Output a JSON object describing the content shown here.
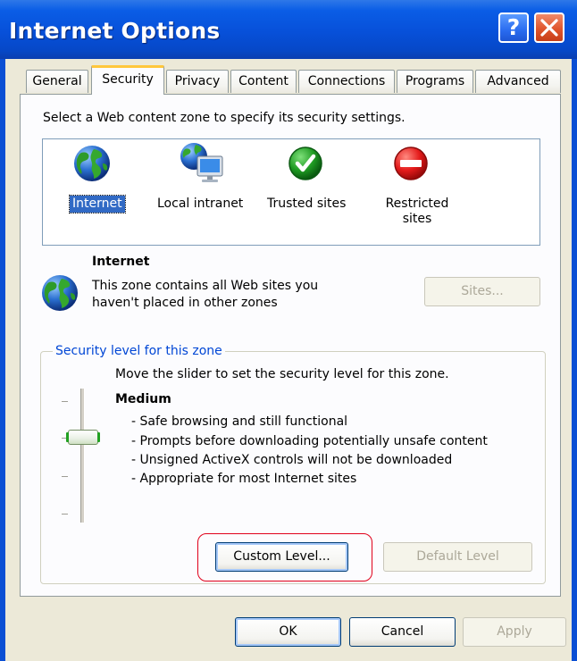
{
  "window": {
    "title": "Internet Options"
  },
  "titlebar_buttons": {
    "help": "?",
    "close": "close"
  },
  "tabs": [
    {
      "label": "General",
      "active": false
    },
    {
      "label": "Security",
      "active": true
    },
    {
      "label": "Privacy",
      "active": false
    },
    {
      "label": "Content",
      "active": false
    },
    {
      "label": "Connections",
      "active": false
    },
    {
      "label": "Programs",
      "active": false
    },
    {
      "label": "Advanced",
      "active": false
    }
  ],
  "security": {
    "instruction": "Select a Web content zone to specify its security settings.",
    "zones": [
      {
        "label": "Internet",
        "icon": "globe-icon",
        "selected": true
      },
      {
        "label": "Local intranet",
        "icon": "local-intranet-icon",
        "selected": false
      },
      {
        "label": "Trusted sites",
        "icon": "checkmark-icon",
        "selected": false
      },
      {
        "label_line1": "Restricted",
        "label_line2": "sites",
        "icon": "restricted-icon",
        "selected": false
      }
    ],
    "selected_zone": {
      "title": "Internet",
      "desc_line1": "This zone contains all Web sites you",
      "desc_line2": "haven't placed in other zones",
      "sites_button": "Sites..."
    },
    "level_group": {
      "label": "Security level for this zone",
      "instruction": "Move the slider to set the security level for this zone.",
      "level": "Medium",
      "bullets": [
        "- Safe browsing and still functional",
        "- Prompts before downloading potentially unsafe content",
        "- Unsigned ActiveX controls will not be downloaded",
        "- Appropriate for most Internet sites"
      ],
      "custom_button": "Custom Level...",
      "default_button": "Default Level"
    }
  },
  "footer": {
    "ok": "OK",
    "cancel": "Cancel",
    "apply": "Apply"
  },
  "colors": {
    "titlebar": "#0a5de6",
    "highlight": "#e0001a",
    "active_tab_accent": "#ffc73c",
    "group_label": "#0046d5"
  }
}
